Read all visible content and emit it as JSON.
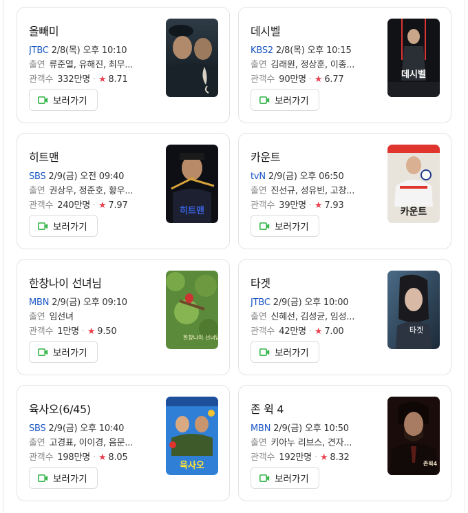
{
  "cards": [
    {
      "title": "올빼미",
      "channel": "JTBC",
      "schedule": "2/8(목) 오후 10:10",
      "cast_label": "출연",
      "cast": "류준열, 유해진, 최무...",
      "audience_label": "관객수",
      "audience": "332만명",
      "rating": "8.71",
      "watch_label": "보러가기",
      "poster_icon": "owl-movie-poster"
    },
    {
      "title": "데시벨",
      "channel": "KBS2",
      "schedule": "2/8(목) 오후 10:15",
      "cast_label": "출연",
      "cast": "김래원, 정상훈, 이종...",
      "audience_label": "관객수",
      "audience": "90만명",
      "rating": "6.77",
      "watch_label": "보러가기",
      "poster_icon": "decibel-movie-poster",
      "poster_text": "데시벨"
    },
    {
      "title": "히트맨",
      "channel": "SBS",
      "schedule": "2/9(금) 오전 09:40",
      "cast_label": "출연",
      "cast": "권상우, 정준호, 황우...",
      "audience_label": "관객수",
      "audience": "240만명",
      "rating": "7.97",
      "watch_label": "보러가기",
      "poster_icon": "hitman-movie-poster",
      "poster_text": "히트맨"
    },
    {
      "title": "카운트",
      "channel": "tvN",
      "schedule": "2/9(금) 오후 06:50",
      "cast_label": "출연",
      "cast": "진선규, 성유빈, 고창...",
      "audience_label": "관객수",
      "audience": "39만명",
      "rating": "7.93",
      "watch_label": "보러가기",
      "poster_icon": "count-movie-poster",
      "poster_text": "카운트"
    },
    {
      "title": "한창나이 선녀님",
      "channel": "MBN",
      "schedule": "2/9(금) 오후 09:10",
      "cast_label": "출연",
      "cast": "임선녀",
      "audience_label": "관객수",
      "audience": "1만명",
      "rating": "9.50",
      "watch_label": "보러가기",
      "poster_icon": "fairy-movie-poster",
      "poster_text": "한창나이 선녀님"
    },
    {
      "title": "타겟",
      "channel": "JTBC",
      "schedule": "2/9(금) 오후 10:00",
      "cast_label": "출연",
      "cast": "신혜선, 김성균, 임성...",
      "audience_label": "관객수",
      "audience": "42만명",
      "rating": "7.00",
      "watch_label": "보러가기",
      "poster_icon": "target-movie-poster",
      "poster_text": "타겟"
    },
    {
      "title": "육사오(6/45)",
      "channel": "SBS",
      "schedule": "2/9(금) 오후 10:40",
      "cast_label": "출연",
      "cast": "고경표, 이이경, 음문...",
      "audience_label": "관객수",
      "audience": "198만명",
      "rating": "8.05",
      "watch_label": "보러가기",
      "poster_icon": "six45-movie-poster",
      "poster_text": "육사오"
    },
    {
      "title": "존 윅 4",
      "channel": "MBN",
      "schedule": "2/9(금) 오후 10:50",
      "cast_label": "출연",
      "cast": "키아누 리브스, 견자...",
      "audience_label": "관객수",
      "audience": "192만명",
      "rating": "8.32",
      "watch_label": "보러가기",
      "poster_icon": "john-wick-movie-poster",
      "poster_text": "존윅4"
    }
  ],
  "colors": {
    "channel": "#1a56c4",
    "star": "#e8414e",
    "camera": "#35b54a"
  },
  "icons": {
    "watch": "video-camera-icon",
    "rating": "star-icon"
  }
}
